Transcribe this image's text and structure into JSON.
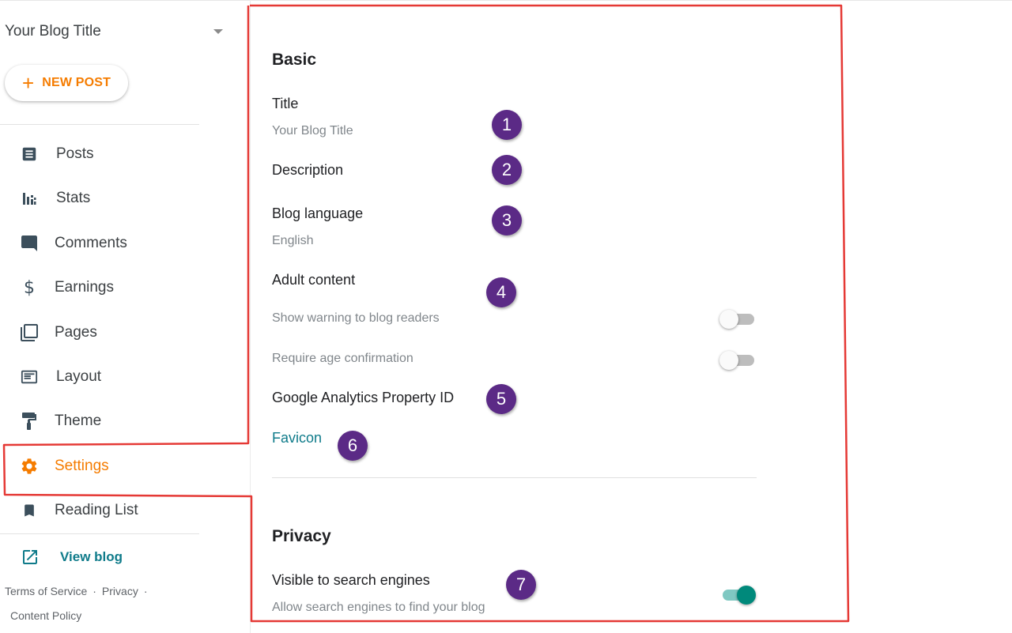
{
  "sidebar": {
    "blog_title": "Your Blog Title",
    "new_post_label": "NEW POST",
    "nav": [
      {
        "label": "Posts",
        "icon": "posts-icon"
      },
      {
        "label": "Stats",
        "icon": "stats-icon"
      },
      {
        "label": "Comments",
        "icon": "comments-icon"
      },
      {
        "label": "Earnings",
        "icon": "dollar-icon"
      },
      {
        "label": "Pages",
        "icon": "pages-icon"
      },
      {
        "label": "Layout",
        "icon": "layout-icon"
      },
      {
        "label": "Theme",
        "icon": "paint-roller-icon"
      },
      {
        "label": "Settings",
        "icon": "gear-icon",
        "active": true
      },
      {
        "label": "Reading List",
        "icon": "bookmark-icon"
      }
    ],
    "view_blog_label": "View blog",
    "footer": {
      "terms": "Terms of Service",
      "privacy": "Privacy",
      "content_policy": "Content Policy"
    }
  },
  "basic": {
    "section_title": "Basic",
    "title_label": "Title",
    "title_value": "Your Blog Title",
    "description_label": "Description",
    "language_label": "Blog language",
    "language_value": "English",
    "adult_label": "Adult content",
    "show_warning_label": "Show warning to blog readers",
    "show_warning_on": false,
    "age_confirm_label": "Require age confirmation",
    "age_confirm_on": false,
    "analytics_label": "Google Analytics Property ID",
    "favicon_label": "Favicon"
  },
  "privacy": {
    "section_title": "Privacy",
    "visible_label": "Visible to search engines",
    "visible_desc": "Allow search engines to find your blog",
    "visible_on": true
  },
  "callouts": [
    "1",
    "2",
    "3",
    "4",
    "5",
    "6",
    "7"
  ],
  "colors": {
    "accent_orange": "#f57c00",
    "link_teal": "#0f7b8a",
    "toggle_on": "#00897b",
    "callout_purple": "#5b2a86",
    "annotation_red": "#e53935"
  }
}
